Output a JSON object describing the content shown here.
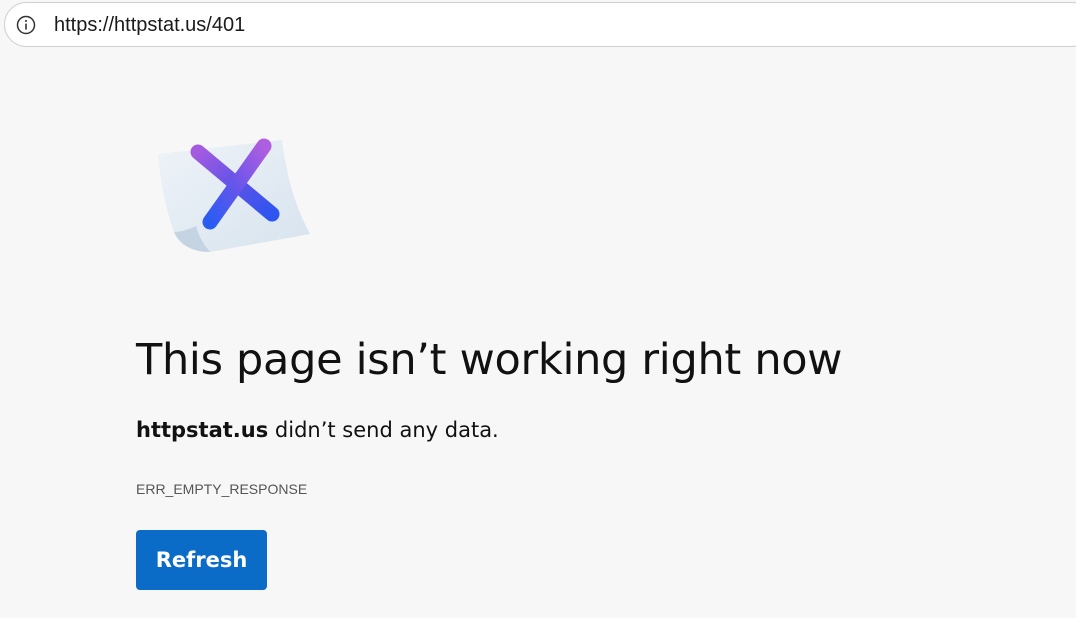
{
  "browser": {
    "address_bar": {
      "url": "https://httpstat.us/401",
      "site_info_icon": "info-icon"
    }
  },
  "error_page": {
    "illustration_icon": "error-x-page-icon",
    "title": "This page isn’t working right now",
    "message_host": "httpstat.us",
    "message_rest": " didn’t send any data.",
    "error_code": "ERR_EMPTY_RESPONSE",
    "refresh_label": "Refresh"
  },
  "colors": {
    "page_background": "#f7f7f7",
    "button_background": "#0a6cc7",
    "button_text": "#ffffff"
  }
}
